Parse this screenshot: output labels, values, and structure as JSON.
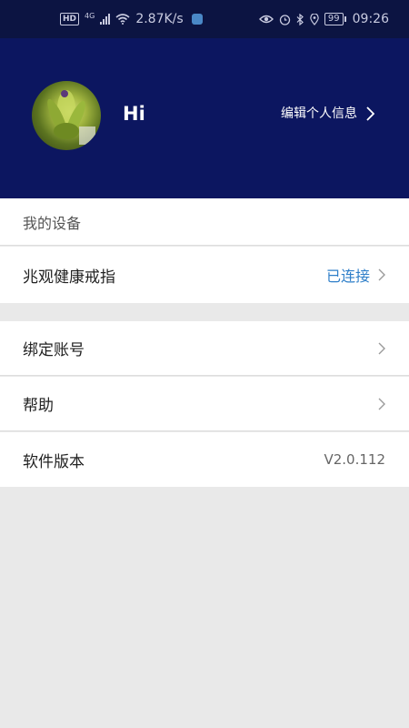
{
  "status_bar": {
    "hd_badge": "HD",
    "network": "4G",
    "speed": "2.87K/s",
    "battery": "99",
    "time": "09:26"
  },
  "profile": {
    "greeting": "Hi",
    "edit_label": "编辑个人信息"
  },
  "my_devices": {
    "title": "我的设备",
    "device_name": "兆观健康戒指",
    "device_status": "已连接"
  },
  "settings": {
    "bind_account": "绑定账号",
    "help": "帮助",
    "version_label": "软件版本",
    "version_value": "V2.0.112"
  },
  "colors": {
    "header_bg": "#0c1660",
    "status_bar_bg": "#0c1442",
    "accent": "#2f7fc9",
    "page_bg": "#e9e9e9"
  }
}
